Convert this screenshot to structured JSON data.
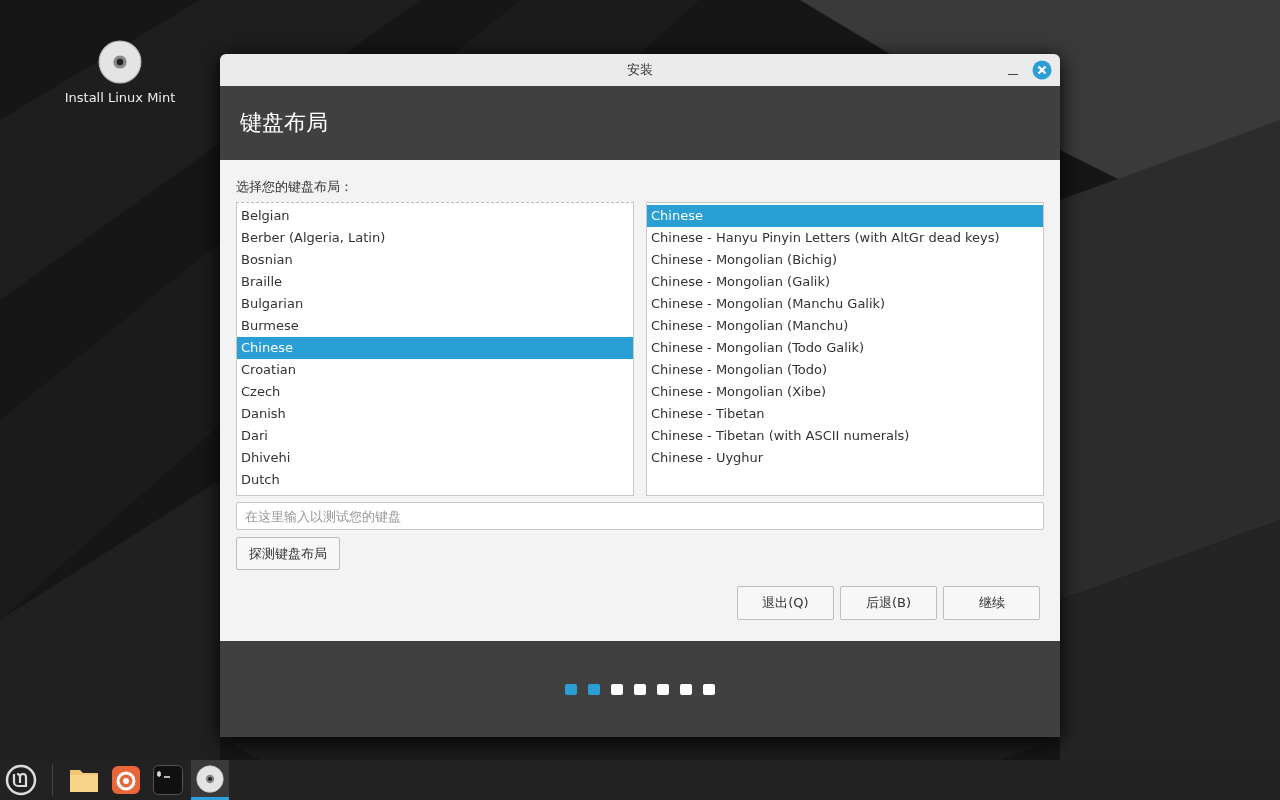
{
  "desktop_icons": [
    {
      "label": "Install Linux Mint"
    }
  ],
  "window": {
    "title": "安装",
    "heading": "键盘布局"
  },
  "prompt": "选择您的键盘布局：",
  "layouts": [
    {
      "label": "Belgian",
      "selected": false
    },
    {
      "label": "Berber (Algeria, Latin)",
      "selected": false
    },
    {
      "label": "Bosnian",
      "selected": false
    },
    {
      "label": "Braille",
      "selected": false
    },
    {
      "label": "Bulgarian",
      "selected": false
    },
    {
      "label": "Burmese",
      "selected": false
    },
    {
      "label": "Chinese",
      "selected": true
    },
    {
      "label": "Croatian",
      "selected": false
    },
    {
      "label": "Czech",
      "selected": false
    },
    {
      "label": "Danish",
      "selected": false
    },
    {
      "label": "Dari",
      "selected": false
    },
    {
      "label": "Dhivehi",
      "selected": false
    },
    {
      "label": "Dutch",
      "selected": false
    }
  ],
  "variants": [
    {
      "label": "Chinese",
      "selected": true
    },
    {
      "label": "Chinese - Hanyu Pinyin Letters (with AltGr dead keys)",
      "selected": false
    },
    {
      "label": "Chinese - Mongolian (Bichig)",
      "selected": false
    },
    {
      "label": "Chinese - Mongolian (Galik)",
      "selected": false
    },
    {
      "label": "Chinese - Mongolian (Manchu Galik)",
      "selected": false
    },
    {
      "label": "Chinese - Mongolian (Manchu)",
      "selected": false
    },
    {
      "label": "Chinese - Mongolian (Todo Galik)",
      "selected": false
    },
    {
      "label": "Chinese - Mongolian (Todo)",
      "selected": false
    },
    {
      "label": "Chinese - Mongolian (Xibe)",
      "selected": false
    },
    {
      "label": "Chinese - Tibetan",
      "selected": false
    },
    {
      "label": "Chinese - Tibetan (with ASCII numerals)",
      "selected": false
    },
    {
      "label": "Chinese - Uyghur",
      "selected": false
    }
  ],
  "test_field": {
    "placeholder": "在这里输入以测试您的键盘"
  },
  "detect_button": "探测键盘布局",
  "buttons": [
    "退出(Q)",
    "后退(B)",
    "继续"
  ],
  "steps": [
    {
      "completed": true
    },
    {
      "completed": true
    },
    {
      "completed": false
    },
    {
      "completed": false
    },
    {
      "completed": false
    },
    {
      "completed": false
    },
    {
      "completed": false
    }
  ],
  "taskbar": [
    {
      "kind": "menu",
      "active": false
    },
    {
      "kind": "folder",
      "active": false
    },
    {
      "kind": "browser",
      "active": false
    },
    {
      "kind": "terminal",
      "active": false
    },
    {
      "kind": "disc",
      "active": true
    }
  ]
}
